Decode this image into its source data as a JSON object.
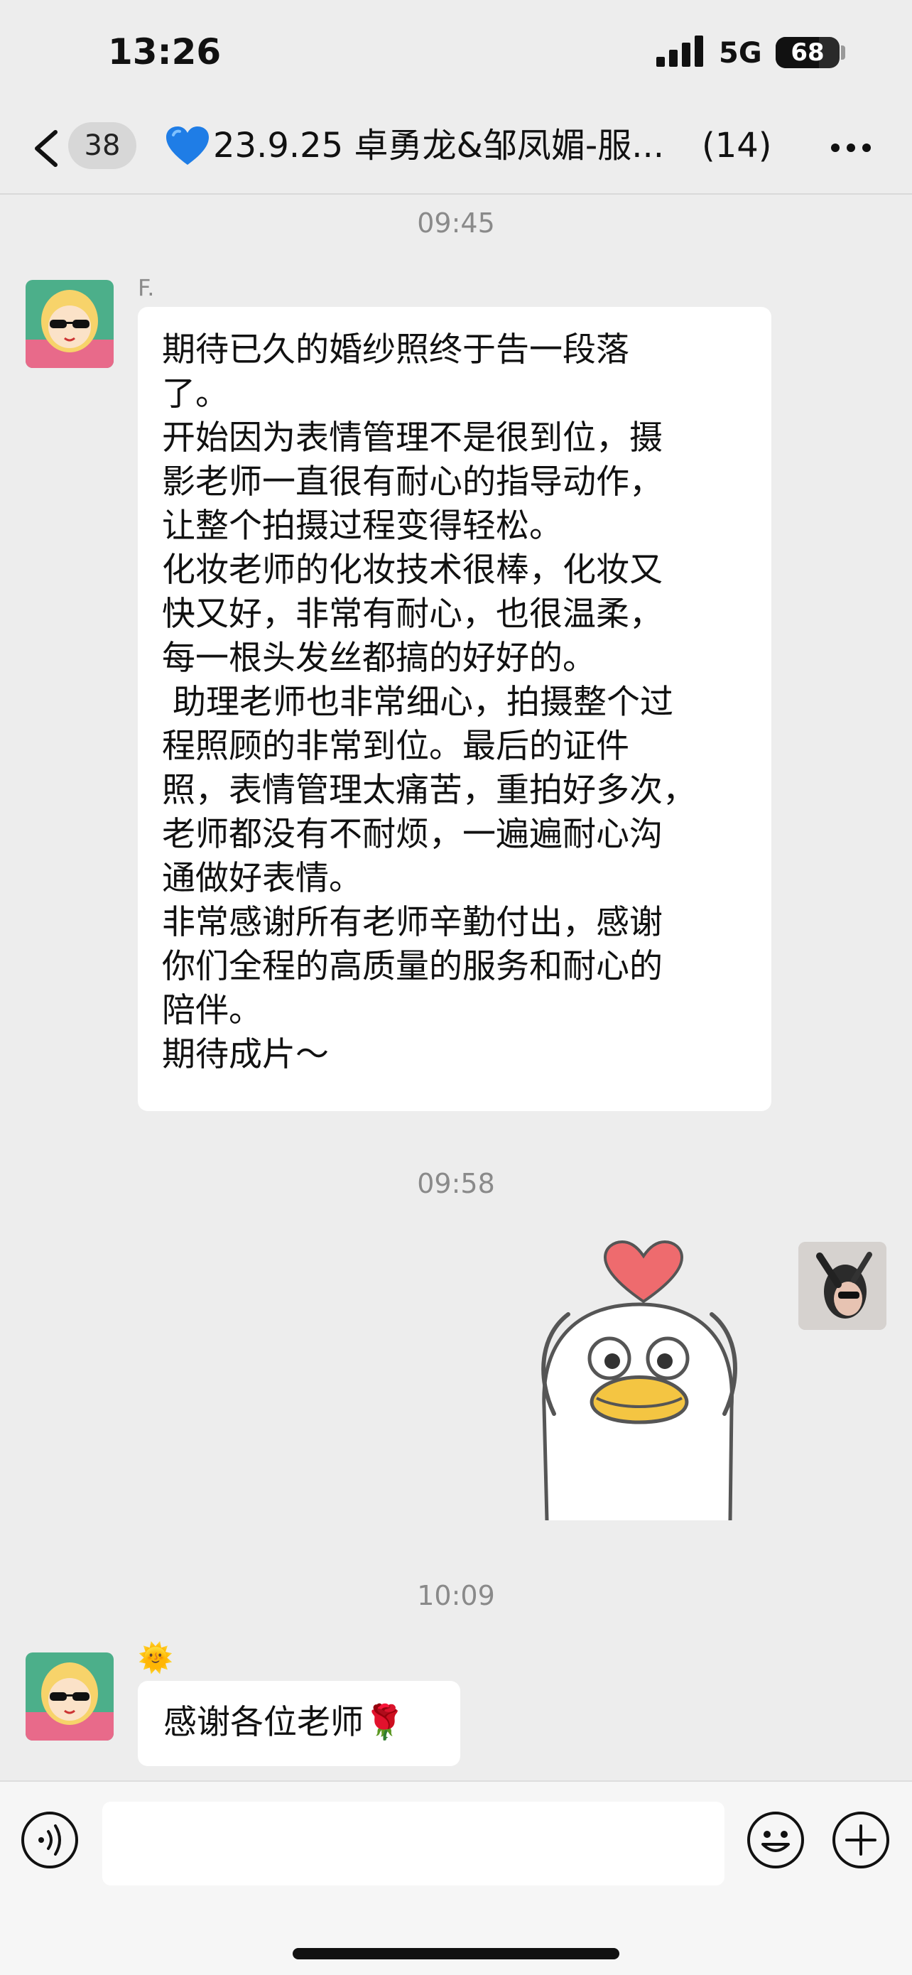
{
  "status": {
    "time": "13:26",
    "network": "5G",
    "battery": "68",
    "battery_level": 0.68
  },
  "nav": {
    "unread_badge": "38",
    "title": "23.9.25 卓勇龙&邹凤媚-服...",
    "member_count": "(14)"
  },
  "messages": {
    "t1": "09:45",
    "m1_sender": "F.",
    "m1_text": "期待已久的婚纱照终于告一段落\n了。\n开始因为表情管理不是很到位，摄\n影老师一直很有耐心的指导动作，\n让整个拍摄过程变得轻松。\n化妆老师的化妆技术很棒，化妆又\n快又好，非常有耐心，也很温柔，\n每一根头发丝都搞的好好的。\n 助理老师也非常细心，拍摄整个过\n程照顾的非常到位。最后的证件\n照，表情管理太痛苦，重拍好多次，\n老师都没有不耐烦，一遍遍耐心沟\n通做好表情。\n非常感谢所有老师辛勤付出，感谢\n你们全程的高质量的服务和耐心的\n陪伴。\n期待成片～",
    "t2": "09:58",
    "t3": "10:09",
    "m3_sender": "🌞",
    "m3_text": "感谢各位老师🌹"
  },
  "icons": {
    "back": "chevron-left-icon",
    "heart": "blue-heart-icon",
    "more": "more-dots-icon",
    "voice": "voice-icon",
    "emoji": "emoji-icon",
    "plus": "plus-icon"
  },
  "colors": {
    "background": "#ededed",
    "bubble": "#ffffff",
    "heart": "#1f7de6",
    "sticker_heart": "#ee6b6e",
    "sticker_beak": "#f4c542"
  }
}
